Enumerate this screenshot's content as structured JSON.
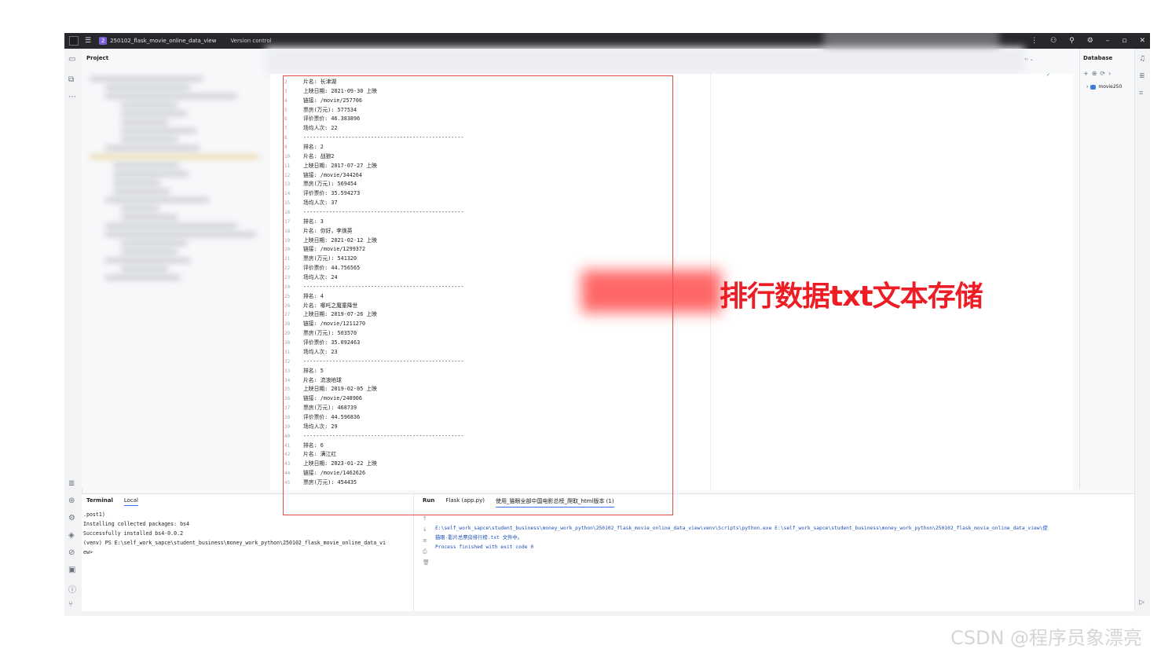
{
  "titlebar": {
    "badge": "2",
    "project_name": "250102_flask_movie_online_data_view",
    "version_control": "Version control"
  },
  "project_panel": {
    "title": "Project"
  },
  "editor": {
    "gutter": [
      "2",
      "3",
      "4",
      "5",
      "6",
      "7",
      "8",
      "9",
      "10",
      "11",
      "12",
      "13",
      "14",
      "15",
      "16",
      "17",
      "18",
      "19",
      "20",
      "21",
      "22",
      "23",
      "24",
      "25",
      "26",
      "27",
      "28",
      "29",
      "30",
      "31",
      "32",
      "33",
      "34",
      "35",
      "36",
      "37",
      "38",
      "39",
      "40",
      "41",
      "42",
      "43",
      "44",
      "45"
    ],
    "lines": [
      "片名: 长津湖",
      "上映日期: 2021-09-30 上映",
      "链接: /movie/257706",
      "票房(万元): 577534",
      "评价票价: 46.383896",
      "场均人次: 22",
      "--------------------------------------------------",
      "排名: 2",
      "片名: 战狼2",
      "上映日期: 2017-07-27 上映",
      "链接: /movie/344264",
      "票房(万元): 569454",
      "评价票价: 35.594273",
      "场均人次: 37",
      "--------------------------------------------------",
      "排名: 3",
      "片名: 你好，李焕英",
      "上映日期: 2021-02-12 上映",
      "链接: /movie/1299372",
      "票房(万元): 541320",
      "评价票价: 44.756565",
      "场均人次: 24",
      "--------------------------------------------------",
      "排名: 4",
      "片名: 哪吒之魔童降世",
      "上映日期: 2019-07-26 上映",
      "链接: /movie/1211270",
      "票房(万元): 503570",
      "评价票价: 35.092463",
      "场均人次: 23",
      "--------------------------------------------------",
      "排名: 5",
      "片名: 流浪地球",
      "上映日期: 2019-02-05 上映",
      "链接: /movie/248906",
      "票房(万元): 468739",
      "评价票价: 44.596836",
      "场均人次: 29",
      "--------------------------------------------------",
      "排名: 6",
      "片名: 满江红",
      "上映日期: 2023-01-22 上映",
      "链接: /movie/1462626",
      "票房(万元): 454435"
    ]
  },
  "overlay": {
    "caption": "排行数据txt文本存储"
  },
  "database_panel": {
    "title": "Database",
    "node": "movie250"
  },
  "terminal": {
    "tab_title": "Terminal",
    "tab_local": "Local",
    "lines": [
      ".post1)",
      "Installing collected packages: bs4",
      "Successfully installed bs4-0.0.2",
      "(venv) PS E:\\self_work_sapce\\student_business\\money_work_python\\250102_flask_movie_online_data_vi",
      "ew>"
    ]
  },
  "run": {
    "tab_run": "Run",
    "tab_flask": "Flask (app.py)",
    "tab_script": "使用_猫眼全部中国电影总榜_爬取_html版本 (1)",
    "lines": [
      "E:\\self_work_sapce\\student_business\\money_work_python\\250102_flask_movie_online_data_view\\venv\\Scripts\\python.exe E:\\self_work_sapce\\student_business\\money_work_python\\250102_flask_movie_online_data_view\\使",
      "猫眼-影片总票房排行榜.txt 文件中。",
      "",
      "Process finished with exit code 0"
    ]
  },
  "watermark": "CSDN @程序员象漂亮",
  "colors": {
    "accent": "#3574f0",
    "highlight_red": "#e34a4a",
    "caption_red": "#ee1c24"
  }
}
